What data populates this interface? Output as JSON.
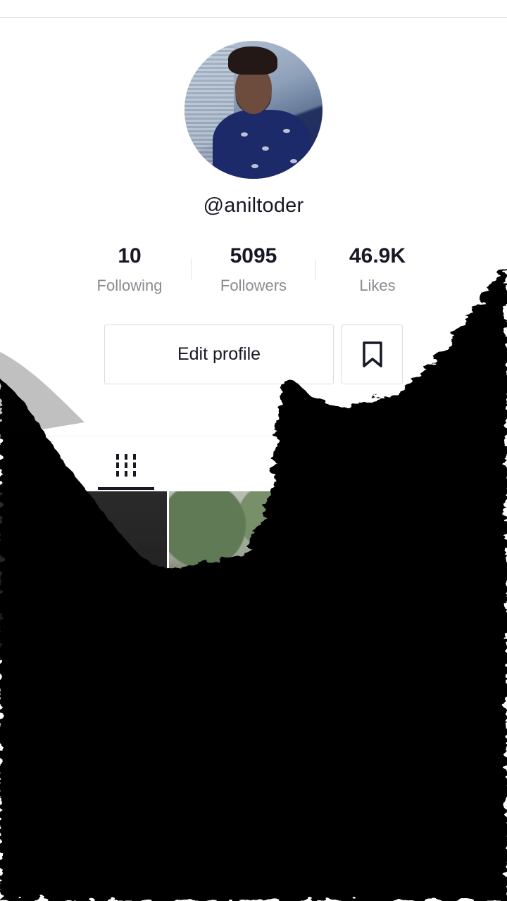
{
  "profile": {
    "username": "@aniltoder",
    "stats": [
      {
        "value": "10",
        "label": "Following"
      },
      {
        "value": "5095",
        "label": "Followers"
      },
      {
        "value": "46.9K",
        "label": "Likes"
      }
    ]
  },
  "actions": {
    "edit_label": "Edit profile"
  },
  "icons": {
    "favorites": "bookmark-icon",
    "videos_tab": "grid-icon"
  },
  "colors": {
    "text": "#161823",
    "secondary_text": "#8a8b91",
    "border": "#dcdcdc",
    "overlay": "#050505"
  }
}
